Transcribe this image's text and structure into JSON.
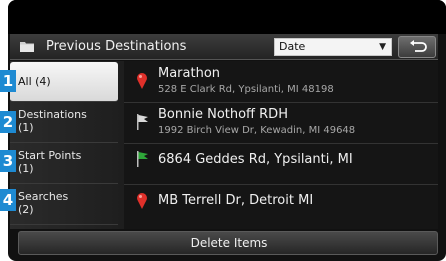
{
  "header": {
    "title": "Previous Destinations",
    "sort_value": "Date",
    "folder_icon": "folder-icon",
    "back_icon": "back-arrow-icon"
  },
  "tabs": [
    {
      "marker": "1",
      "label": "All (4)",
      "active": true
    },
    {
      "marker": "2",
      "label": "Destinations",
      "count": "(1)"
    },
    {
      "marker": "3",
      "label": "Start Points",
      "count": "(1)"
    },
    {
      "marker": "4",
      "label": "Searches",
      "count": "(2)"
    }
  ],
  "items": [
    {
      "title": "Marathon",
      "subtitle": "528 E Clark Rd, Ypsilanti, MI 48198",
      "icon": "red-pin-icon"
    },
    {
      "title": "Bonnie Nothoff RDH",
      "subtitle": "1992 Birch View Dr, Kewadin, MI 49648",
      "icon": "white-flag-icon"
    },
    {
      "title": "6864 Geddes Rd, Ypsilanti, MI",
      "subtitle": "",
      "icon": "green-flag-icon"
    },
    {
      "title": "MB Terrell Dr, Detroit MI",
      "subtitle": "",
      "icon": "red-pin-icon"
    }
  ],
  "footer": {
    "delete_label": "Delete Items"
  },
  "colors": {
    "marker_blue": "#1e8ad2",
    "pin_red": "#e0302a",
    "flag_green": "#2fa83a"
  }
}
